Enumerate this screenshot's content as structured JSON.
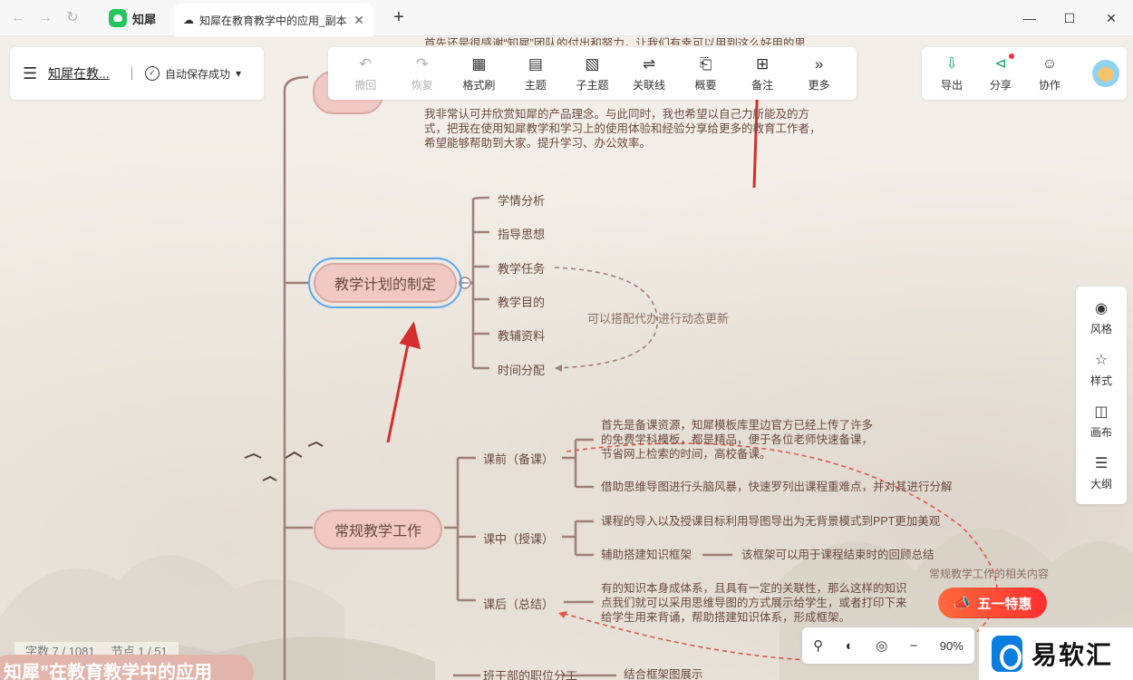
{
  "browser": {
    "app_tab": "知犀",
    "doc_tab": "知犀在教育教学中的应用_副本",
    "new_tab_icon": "plus-icon"
  },
  "docbar": {
    "title": "知犀在教...",
    "save_status": "自动保存成功"
  },
  "toolbar": {
    "items": [
      {
        "label": "撤回",
        "icon": "undo-icon"
      },
      {
        "label": "恢复",
        "icon": "redo-icon"
      },
      {
        "label": "格式刷",
        "icon": "format-brush-icon"
      },
      {
        "label": "主题",
        "icon": "topic-icon"
      },
      {
        "label": "子主题",
        "icon": "subtopic-icon"
      },
      {
        "label": "关联线",
        "icon": "relation-line-icon"
      },
      {
        "label": "概要",
        "icon": "summary-icon"
      },
      {
        "label": "备注",
        "icon": "note-icon"
      },
      {
        "label": "更多",
        "icon": "more-icon"
      }
    ]
  },
  "right_toolbar": {
    "items": [
      {
        "label": "导出",
        "icon": "export-icon"
      },
      {
        "label": "分享",
        "icon": "share-icon"
      },
      {
        "label": "协作",
        "icon": "collaborate-icon"
      }
    ]
  },
  "side_panel": {
    "items": [
      {
        "label": "风格",
        "icon": "palette-icon"
      },
      {
        "label": "样式",
        "icon": "style-icon"
      },
      {
        "label": "画布",
        "icon": "canvas-icon"
      },
      {
        "label": "大纲",
        "icon": "outline-icon"
      }
    ]
  },
  "mindmap": {
    "top_text": {
      "line0": "首先还是很感谢“知犀”团队的付出和努力，让我们有幸可以用到这么好用的思",
      "line1": "我非常认可并欣赏知犀的产品理念。与此同时，我也希望以自己力所能及的方",
      "line2": "式，把我在使用知犀教学和学习上的使用体验和经验分享给更多的教育工作者，",
      "line3": "希望能够帮助到大家。提升学习、办公效率。"
    },
    "topic1": {
      "label": "教学计划的制定",
      "children": [
        "学情分析",
        "指导思想",
        "教学任务",
        "教学目的",
        "教辅资料",
        "时间分配"
      ],
      "relation_label": "可以搭配代办进行动态更新"
    },
    "topic2": {
      "label": "常规教学工作",
      "pre": {
        "label": "课前（备课）",
        "note1_line1": "首先是备课资源，知犀模板库里边官方已经上传了许多",
        "note1_line2": "的免费学科模板，都是精品，便于各位老师快速备课，",
        "note1_line3": "节省网上检索的时间，高校备课。",
        "note2": "借助思维导图进行头脑风暴，快速罗列出课程重难点，并对其进行分解"
      },
      "mid": {
        "label": "课中（授课）",
        "note1": "课程的导入以及授课目标利用导图导出为无背景模式到PPT更加美观",
        "note2": "辅助搭建知识框架",
        "note3": "该框架可以用于课程结束时的回顾总结"
      },
      "post": {
        "label": "课后（总结）",
        "note_line1": "有的知识本身成体系，且具有一定的关联性，那么这样的知识",
        "note_line2": "点我们就可以采用思维导图的方式展示给学生，或者打印下来",
        "note_line3": "给学生用来背诵，帮助搭建知识体系，形成框架。"
      },
      "relation_label": "常规教学工作的相关内容"
    },
    "bottom": {
      "item": "班干部的职位分工",
      "note": "结合框架图展示"
    },
    "root_label": "知犀”在教育教学中的应用"
  },
  "status": {
    "word_count": "字数 7 / 1081",
    "node_count": "节点 1 / 51",
    "zoom": "90%"
  },
  "promo": {
    "label": "五一特惠"
  },
  "brand": {
    "name": "易软汇"
  },
  "colors": {
    "branch": "#a07f79",
    "topic_fill": "#f0c9c4",
    "annotation_arrow": "#d62d2d",
    "relation_dashed": "#e0564a",
    "accent_green": "#19a660"
  }
}
